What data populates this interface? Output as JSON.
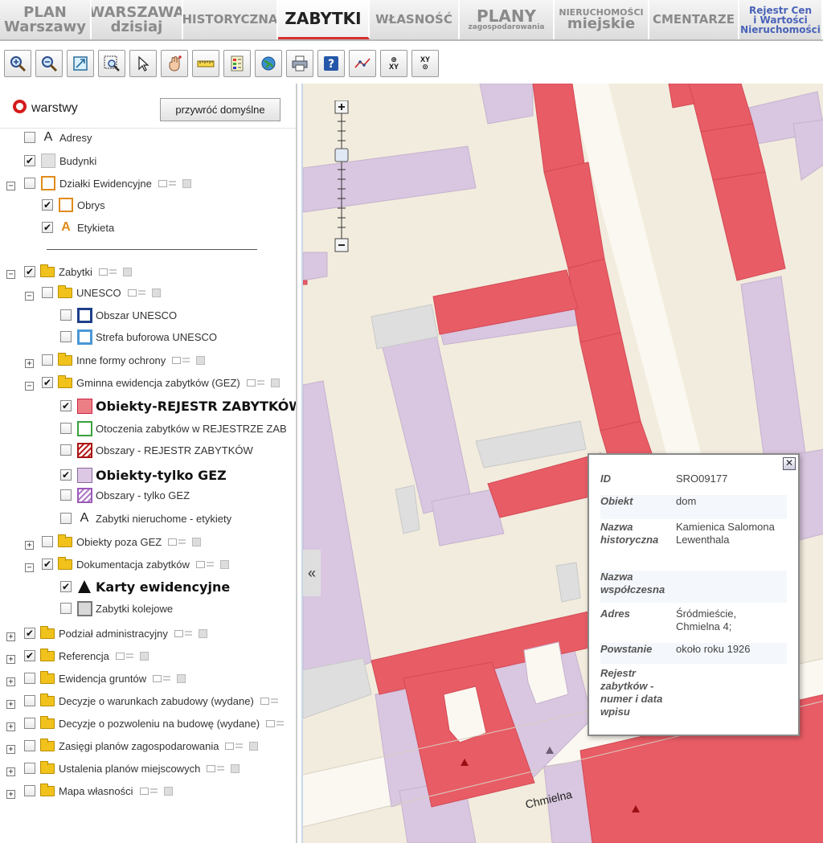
{
  "nav": {
    "tabs": [
      {
        "line1": "PLAN",
        "line2": "Warszawy"
      },
      {
        "line1": "WARSZAWA",
        "line2": "dzisiaj"
      },
      {
        "line1": "HISTORYCZNA"
      },
      {
        "line1": "ZABYTKI"
      },
      {
        "line1": "WŁASNOŚĆ"
      },
      {
        "line1": "PLANY",
        "line2": "zagospodarowania"
      },
      {
        "line1": "NIERUCHOMOŚCI",
        "line2": "miejskie"
      },
      {
        "line1": "CMENTARZE"
      },
      {
        "line1": "Rejestr Cen",
        "line2": "i Wartości",
        "line3": "Nieruchomości"
      }
    ],
    "active_color": "#d43131"
  },
  "toolbar": {
    "tools": [
      "zoom-in-icon",
      "zoom-out-icon",
      "full-extent-icon",
      "zoom-window-icon",
      "select-arrow-icon",
      "pan-hand-icon",
      "measure-ruler-icon",
      "legend-icon",
      "globe-icon",
      "print-icon",
      "help-icon",
      "profile-line-icon"
    ],
    "xy_label": "XY"
  },
  "panel": {
    "title": "warstwy",
    "restore_label": "przywróć domyślne",
    "layers": {
      "adresy": "Adresy",
      "budynki": "Budynki",
      "dzialki": "Działki Ewidencyjne",
      "obrys": "Obrys",
      "etykieta": "Etykieta",
      "zabytki": "Zabytki",
      "unesco": "UNESCO",
      "obszar_unesco": "Obszar UNESCO",
      "strefa_unesco": "Strefa buforowa UNESCO",
      "inne_formy": "Inne formy ochrony",
      "gez": "Gminna ewidencja zabytków (GEZ)",
      "obiekty_rejestr": "Obiekty-REJESTR ZABYTKÓW",
      "otoczenia": "Otoczenia zabytków w REJESTRZE ZAB",
      "obszary_rejestr": "Obszary - REJESTR ZABYTKÓW",
      "obiekty_gez": "Obiekty-tylko GEZ",
      "obszary_gez": "Obszary - tylko GEZ",
      "etykiety": "Zabytki nieruchome - etykiety",
      "poza_gez": "Obiekty poza GEZ",
      "dokumentacja": "Dokumentacja zabytków",
      "karty": "Karty ewidencyjne",
      "kolejowe": "Zabytki kolejowe",
      "podzial": "Podział administracyjny",
      "referencja": "Referencja",
      "ewidencja": "Ewidencja gruntów",
      "decyzje_wz": "Decyzje o warunkach zabudowy (wydane)",
      "decyzje_pnb": "Decyzje o pozwoleniu na budowę (wydane)",
      "zasiegi": "Zasięgi planów zagospodarowania",
      "ustalenia": "Ustalenia planów miejscowych",
      "mapa_wlasnosci": "Mapa własności"
    },
    "symbol_letter": "A",
    "expand": "+",
    "collapse": "−",
    "check": "✔"
  },
  "map": {
    "street": "Chmielna",
    "collapse_label": "«",
    "colors": {
      "background": "#f2ecde",
      "rejestr": "#e85c66",
      "gez": "#d9c6e0",
      "other": "#dcdcdc"
    }
  },
  "popup": {
    "close": "✕",
    "rows": [
      {
        "key": "ID",
        "value": "SRO09177"
      },
      {
        "key": "Obiekt",
        "value": "dom"
      },
      {
        "key": "Nazwa historyczna",
        "value": "Kamienica Salomona Lewenthala"
      },
      {
        "key": "Nazwa współczesna",
        "value": ""
      },
      {
        "key": "Adres",
        "value": "Śródmieście, Chmielna 4;"
      },
      {
        "key": "Powstanie",
        "value": "około roku 1926"
      },
      {
        "key": "Rejestr zabytków - numer i data wpisu",
        "value": ""
      }
    ]
  }
}
